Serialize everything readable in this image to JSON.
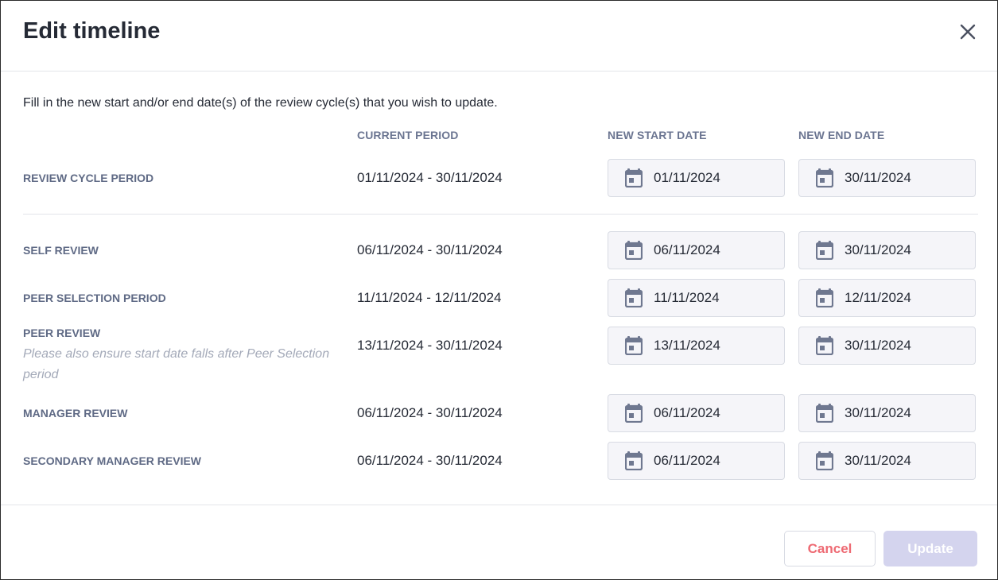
{
  "dialog": {
    "title": "Edit timeline",
    "close_icon": "close-icon"
  },
  "instructions": "Fill in the new start and/or end date(s) of the review cycle(s) that you wish to update.",
  "columns": {
    "current_period": "CURRENT PERIOD",
    "new_start_date": "NEW START DATE",
    "new_end_date": "NEW END DATE"
  },
  "rows": [
    {
      "label": "REVIEW CYCLE PERIOD",
      "note": "",
      "current_period": "01/11/2024 - 30/11/2024",
      "new_start": "01/11/2024",
      "new_end": "30/11/2024"
    },
    {
      "label": "SELF REVIEW",
      "note": "",
      "current_period": "06/11/2024 - 30/11/2024",
      "new_start": "06/11/2024",
      "new_end": "30/11/2024"
    },
    {
      "label": "PEER SELECTION PERIOD",
      "note": "",
      "current_period": "11/11/2024 - 12/11/2024",
      "new_start": "11/11/2024",
      "new_end": "12/11/2024"
    },
    {
      "label": "PEER REVIEW",
      "note": "Please also ensure start date falls after Peer Selection period",
      "current_period": "13/11/2024 - 30/11/2024",
      "new_start": "13/11/2024",
      "new_end": "30/11/2024"
    },
    {
      "label": "MANAGER REVIEW",
      "note": "",
      "current_period": "06/11/2024 - 30/11/2024",
      "new_start": "06/11/2024",
      "new_end": "30/11/2024"
    },
    {
      "label": "SECONDARY MANAGER REVIEW",
      "note": "",
      "current_period": "06/11/2024 - 30/11/2024",
      "new_start": "06/11/2024",
      "new_end": "30/11/2024"
    }
  ],
  "icons": {
    "date_field": "calendar-icon"
  },
  "footer": {
    "cancel_label": "Cancel",
    "update_label": "Update"
  },
  "colors": {
    "cancel_text": "#ee6a73",
    "update_disabled_bg": "#d4d4ee",
    "label_text": "#5f6a85",
    "input_bg": "#f5f5f9"
  }
}
